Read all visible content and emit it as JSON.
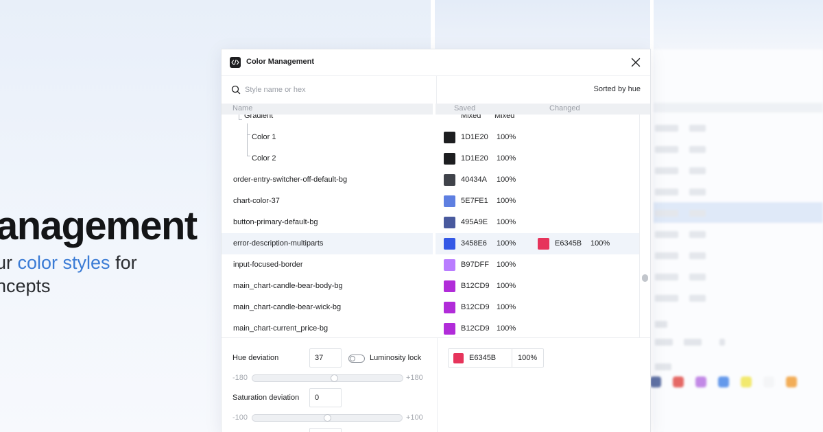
{
  "hero": {
    "title": "anagement",
    "line1_prefix": "ur ",
    "line1_accent": "color styles",
    "line1_suffix": " for",
    "line2": "ncepts",
    "accent_color": "#3a7bd5"
  },
  "dialog": {
    "title": "Color Management",
    "close_icon": "close-icon",
    "app_icon": "code-icon"
  },
  "search": {
    "placeholder": "Style name or hex",
    "value": ""
  },
  "sort_label": "Sorted by hue",
  "columns": {
    "name": "Name",
    "saved": "Saved",
    "changed": "Changed"
  },
  "rows": [
    {
      "name": "Gradient",
      "saved_hex": "Mixed",
      "saved_pct": "Mixed",
      "swatch": ""
    },
    {
      "name": "Color 1",
      "saved_hex": "1D1E20",
      "saved_pct": "100%",
      "swatch": "#1d1e20"
    },
    {
      "name": "Color 2",
      "saved_hex": "1D1E20",
      "saved_pct": "100%",
      "swatch": "#1d1e20"
    },
    {
      "name": "order-entry-switcher-off-default-bg",
      "saved_hex": "40434A",
      "saved_pct": "100%",
      "swatch": "#40434a"
    },
    {
      "name": "chart-color-37",
      "saved_hex": "5E7FE1",
      "saved_pct": "100%",
      "swatch": "#5e7fe1"
    },
    {
      "name": "button-primary-default-bg",
      "saved_hex": "495A9E",
      "saved_pct": "100%",
      "swatch": "#495a9e"
    },
    {
      "name": "error-description-multiparts",
      "saved_hex": "3458E6",
      "saved_pct": "100%",
      "swatch": "#3458e6",
      "changed_hex": "E6345B",
      "changed_pct": "100%",
      "changed_swatch": "#e6345b"
    },
    {
      "name": "input-focused-border",
      "saved_hex": "B97DFF",
      "saved_pct": "100%",
      "swatch": "#b97dff"
    },
    {
      "name": "main_chart-candle-bear-body-bg",
      "saved_hex": "B12CD9",
      "saved_pct": "100%",
      "swatch": "#b12cd9"
    },
    {
      "name": "main_chart-candle-bear-wick-bg",
      "saved_hex": "B12CD9",
      "saved_pct": "100%",
      "swatch": "#b12cd9"
    },
    {
      "name": "main_chart-current_price-bg",
      "saved_hex": "B12CD9",
      "saved_pct": "100%",
      "swatch": "#b12cd9"
    }
  ],
  "hue": {
    "label": "Hue deviation",
    "value": "37",
    "min": "-180",
    "max": "+180",
    "level": 0.55
  },
  "luminosity_lock": {
    "label": "Luminosity lock",
    "enabled": false
  },
  "saturation": {
    "label": "Saturation deviation",
    "value": "0",
    "min": "-100",
    "max": "+100",
    "level": 0.5
  },
  "result_color": {
    "hex": "E6345B",
    "pct": "100%",
    "swatch": "#e6345b"
  },
  "ghost_swatches": [
    "#3a4f8f",
    "#e0423f",
    "#b46be0",
    "#3e80e6",
    "#f0e34a",
    "#f2f3f5",
    "#f0982e"
  ]
}
